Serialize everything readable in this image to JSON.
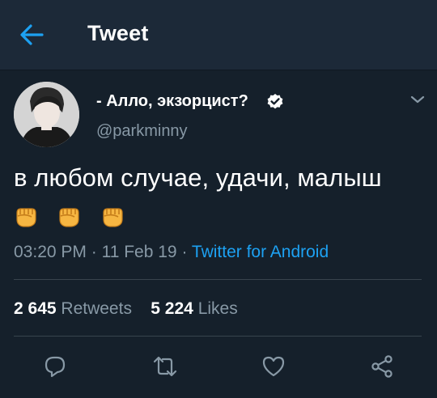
{
  "header": {
    "title": "Tweet"
  },
  "user": {
    "display_name": "- Алло, экзорцист?",
    "handle": "@parkminny"
  },
  "tweet": {
    "text": "в любом случае, удачи, малыш",
    "emojis": [
      "fist-emoji",
      "fist-emoji",
      "fist-emoji"
    ],
    "time": "03:20 PM",
    "date": "11 Feb 19",
    "separator": "·",
    "source": "Twitter for Android"
  },
  "stats": {
    "retweets_count": "2 645",
    "retweets_label": "Retweets",
    "likes_count": "5 224",
    "likes_label": "Likes"
  },
  "actions": [
    "reply-icon",
    "retweet-icon",
    "like-icon",
    "share-icon"
  ],
  "colors": {
    "background": "#15202b",
    "header": "#1c2938",
    "accent": "#1da1f2",
    "muted": "#8899a6",
    "divider": "#38444d"
  }
}
